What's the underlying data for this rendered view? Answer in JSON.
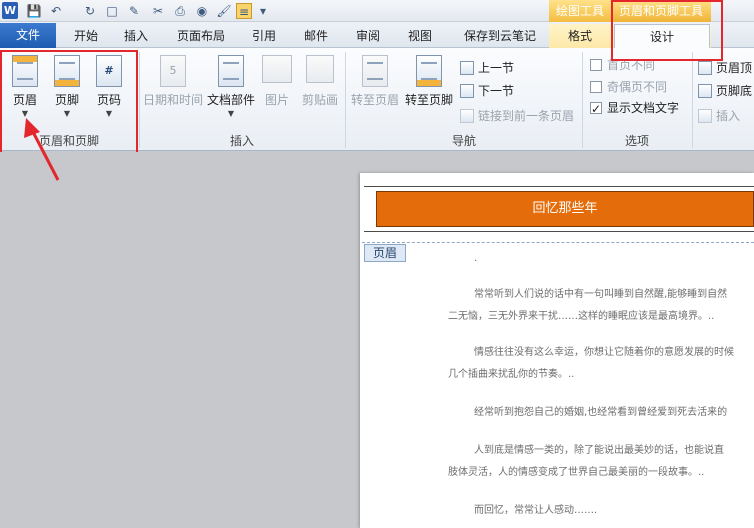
{
  "qat": {
    "app_logo": "W"
  },
  "context": {
    "drawing_tools": "绘图工具",
    "header_footer_tools": "页眉和页脚工具"
  },
  "tabs": [
    "文件",
    "开始",
    "插入",
    "页面布局",
    "引用",
    "邮件",
    "审阅",
    "视图",
    "保存到云笔记",
    "格式",
    "设计"
  ],
  "groups": {
    "header_footer": {
      "label": "页眉和页脚",
      "header": "页眉",
      "footer": "页脚",
      "page_number": "页码"
    },
    "insert": {
      "label": "插入",
      "date_time": "日期和时间",
      "doc_parts": "文档部件",
      "picture": "图片",
      "clip_art": "剪贴画"
    },
    "navigation": {
      "label": "导航",
      "goto_header": "转至页眉",
      "goto_footer": "转至页脚",
      "prev": "上一节",
      "next": "下一节",
      "link_prev": "链接到前一条页眉"
    },
    "options": {
      "label": "选项",
      "diff_first": "首页不同",
      "diff_odd_even": "奇偶页不同",
      "show_text": "显示文档文字"
    },
    "position": {
      "header_top": "页眉顶",
      "footer_bottom": "页脚底",
      "insert_align": "插入"
    }
  },
  "document": {
    "header_text": "回忆那些年",
    "header_tag": "页眉",
    "paragraphs": [
      ".",
      "常常听到人们说的话中有一句叫睡到自然醒,能够睡到自然",
      "二无恼，三无外界来干扰……这样的睡眠应该是最高境界。..",
      "情感往往没有这么幸运，你想让它随着你的意愿发展的时候",
      "几个插曲来扰乱你的节奏。..",
      "经常听到抱怨自己的婚姻,也经常看到曾经爱到死去活来的",
      "人到底是情感一类的，除了能说出最美妙的话，也能说直",
      "肢体灵活，人的情感变成了世界自己最美丽的一段故事。..",
      "而回忆，常常让人感动……."
    ]
  }
}
